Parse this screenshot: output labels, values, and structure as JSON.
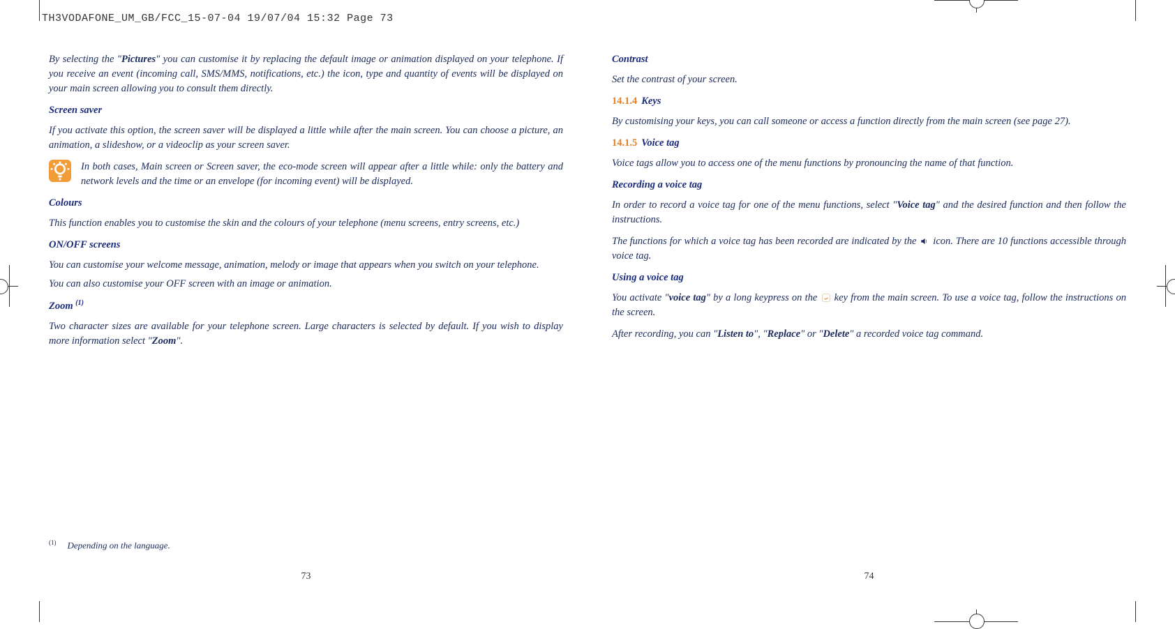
{
  "header": "TH3VODAFONE_UM_GB/FCC_15-07-04  19/07/04  15:32  Page 73",
  "left": {
    "p1_a": "By selecting the \"",
    "p1_bold": "Pictures",
    "p1_b": "\" you can customise it by replacing the default image or animation displayed on your telephone. If you receive an event (incoming call, SMS/MMS, notifications, etc.) the icon, type and quantity of events will be displayed on your main screen allowing you to consult them directly.",
    "h1": "Screen saver",
    "p2": "If you activate this option, the screen saver will be displayed a little while after the main screen. You can choose a picture, an animation, a slideshow, or a videoclip as your screen saver.",
    "note": "In both cases, Main screen or Screen saver, the eco-mode screen will appear after a little while: only the battery and network levels and the time or an envelope (for incoming event) will be displayed.",
    "h2": "Colours",
    "p3": "This function enables you to customise the skin and the colours of your telephone (menu screens, entry screens, etc.)",
    "h3": "ON/OFF screens",
    "p4": "You can customise your welcome message, animation, melody or image that appears when you switch on your telephone.",
    "p5": "You can also customise your OFF screen with an image or animation.",
    "h4_a": "Zoom ",
    "h4_sup": "(1)",
    "p6_a": "Two character sizes are available for your telephone screen. Large characters is selected by default. If you wish to display more information select \"",
    "p6_bold": "Zoom",
    "p6_b": "\".",
    "footnote_mark": "(1)",
    "footnote": "Depending on the language.",
    "pagenum": "73"
  },
  "right": {
    "h1": "Contrast",
    "p1": "Set the contrast of your screen.",
    "sec1_num": "14.1.4",
    "sec1_title": "Keys",
    "p2": "By customising your keys, you can call someone or access a function directly from the main screen (see page 27).",
    "sec2_num": "14.1.5",
    "sec2_title": "Voice tag",
    "p3": "Voice tags allow you to access one of the menu functions by pronouncing the name of that function.",
    "h2": "Recording a voice tag",
    "p4_a": "In order to record a voice tag for one of the menu functions, select \"",
    "p4_bold": "Voice tag",
    "p4_b": "\" and the desired function and then follow the instructions.",
    "p5_a": "The functions for which a voice tag has been recorded are indicated by the ",
    "p5_b": " icon. There are 10 functions accessible through voice tag.",
    "h3": "Using a voice tag",
    "p6_a": "You activate \"",
    "p6_bold": "voice tag",
    "p6_b": "\" by a long keypress on the ",
    "p6_c": " key from the main screen. To use a voice tag, follow the instructions on the screen.",
    "p7_a": "After recording, you can \"",
    "p7_b1": "Listen to",
    "p7_b": "\", \"",
    "p7_b2": "Replace",
    "p7_c": "\" or \"",
    "p7_b3": "Delete",
    "p7_d": "\" a recorded voice tag command.",
    "pagenum": "74"
  }
}
